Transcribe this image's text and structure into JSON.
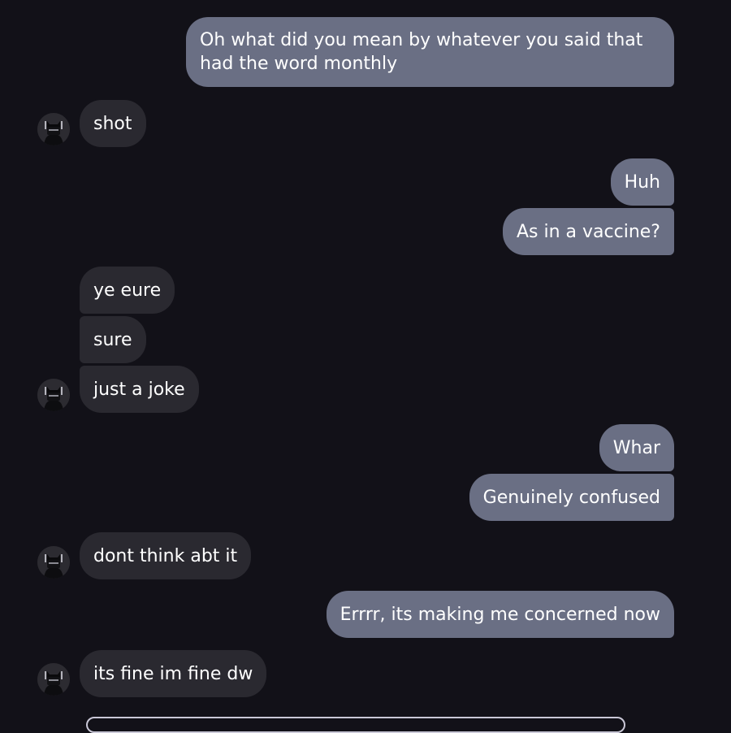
{
  "conversation": {
    "messages": [
      {
        "from": "me",
        "text": "Oh what did you mean by whatever you said that had the word monthly"
      },
      {
        "from": "them",
        "text": "shot"
      },
      {
        "from": "me",
        "text": "Huh"
      },
      {
        "from": "me",
        "text": "As in a vaccine?"
      },
      {
        "from": "them",
        "text": "ye eure"
      },
      {
        "from": "them",
        "text": "sure"
      },
      {
        "from": "them",
        "text": "just a joke"
      },
      {
        "from": "me",
        "text": "Whar"
      },
      {
        "from": "me",
        "text": "Genuinely confused"
      },
      {
        "from": "them",
        "text": "dont think abt it"
      },
      {
        "from": "me",
        "text": "Errrr, its making me concerned now"
      },
      {
        "from": "them",
        "text": "its fine im fine dw"
      }
    ]
  },
  "contact": {
    "avatar_icon": "masked-figure-avatar-icon"
  },
  "colors": {
    "background": "#121118",
    "outgoing_bubble": "#6a6f84",
    "incoming_bubble": "#2a2930",
    "text": "#ffffff"
  }
}
